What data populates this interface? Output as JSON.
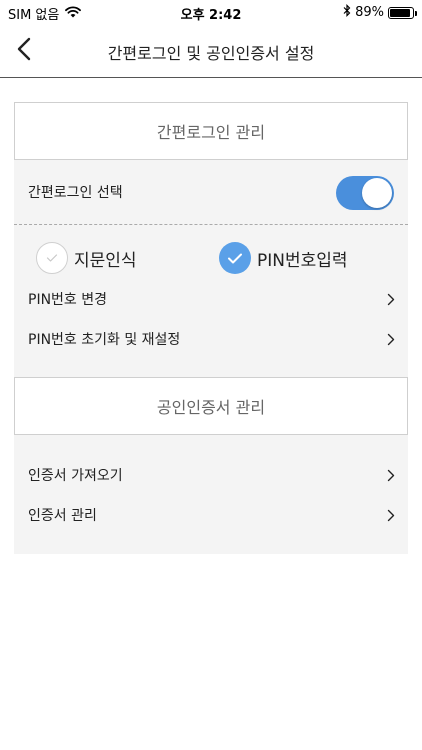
{
  "status_bar": {
    "carrier": "SIM 없음",
    "time": "오후 2:42",
    "battery_percent": "89%",
    "battery_level": 0.89
  },
  "nav": {
    "title": "간편로그인 및 공인인증서 설정"
  },
  "easy_login": {
    "header": "간편로그인 관리",
    "select_label": "간편로그인 선택",
    "toggle_on": true,
    "options": [
      {
        "label": "지문인식",
        "selected": false
      },
      {
        "label": "PIN번호입력",
        "selected": true
      }
    ],
    "items": [
      {
        "label": "PIN번호 변경"
      },
      {
        "label": "PIN번호 초기화 및 재설정"
      }
    ]
  },
  "certificate": {
    "header": "공인인증서 관리",
    "items": [
      {
        "label": "인증서 가져오기"
      },
      {
        "label": "인증서 관리"
      }
    ]
  },
  "colors": {
    "accent": "#4a8fdc",
    "check_selected": "#5aa0e8",
    "panel_bg": "#f4f4f4"
  },
  "icons": {
    "back": "chevron-left-icon",
    "chevron": "chevron-right-icon",
    "wifi": "wifi-icon",
    "bluetooth": "bluetooth-icon",
    "battery": "battery-icon",
    "check": "check-icon"
  }
}
